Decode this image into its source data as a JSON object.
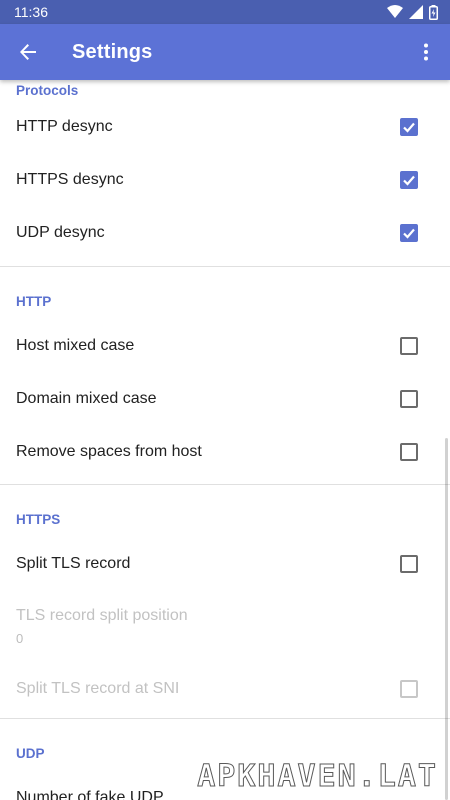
{
  "status_bar": {
    "time": "11:36"
  },
  "app_bar": {
    "title": "Settings"
  },
  "sections": {
    "protocols": {
      "header": "Protocols",
      "http_desync": "HTTP desync",
      "https_desync": "HTTPS desync",
      "udp_desync": "UDP desync"
    },
    "http": {
      "header": "HTTP",
      "host_mixed_case": "Host mixed case",
      "domain_mixed_case": "Domain mixed case",
      "remove_spaces": "Remove spaces from host"
    },
    "https": {
      "header": "HTTPS",
      "split_tls": "Split TLS record",
      "split_position_title": "TLS record split position",
      "split_position_value": "0",
      "split_at_sni": "Split TLS record at SNI"
    },
    "udp": {
      "header": "UDP",
      "fake_udp": "Number of fake UDP"
    }
  },
  "checkbox_states": {
    "http_desync": true,
    "https_desync": true,
    "udp_desync": true,
    "host_mixed_case": false,
    "domain_mixed_case": false,
    "remove_spaces": false,
    "split_tls": false,
    "split_at_sni": false
  },
  "colors": {
    "status_bar": "#4a5fb0",
    "app_bar": "#5c72d6",
    "accent": "#5b71cf"
  },
  "watermark": "APKHAVEN.LAT"
}
